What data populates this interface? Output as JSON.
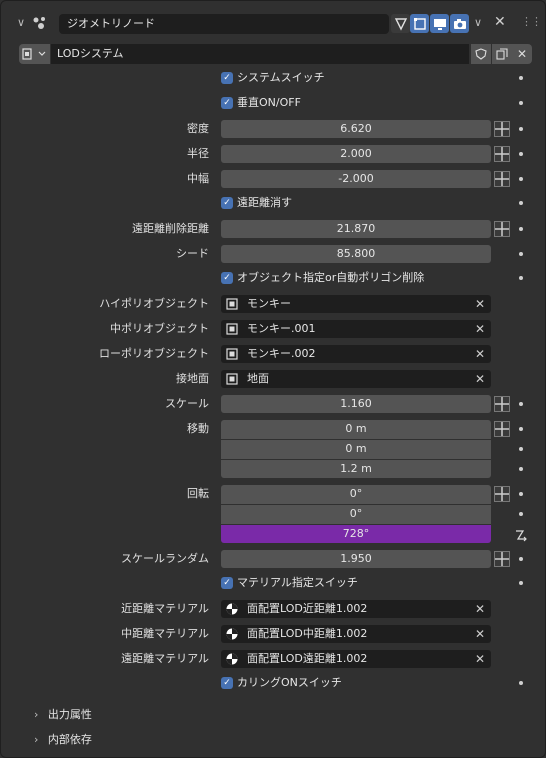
{
  "header": {
    "modifier_name": "ジオメトリノード",
    "nodegroup_name": "LODシステム"
  },
  "rows": {
    "system_switch": "システムスイッチ",
    "vertical_onoff": "垂直ON/OFF",
    "density_label": "密度",
    "density_value": "6.620",
    "radius_label": "半径",
    "radius_value": "2.000",
    "mid_width_label": "中幅",
    "mid_width_value": "-2.000",
    "far_delete": "遠距離消す",
    "far_delete_dist_label": "遠距離削除距離",
    "far_delete_dist_value": "21.870",
    "seed_label": "シード",
    "seed_value": "85.800",
    "object_or_auto": "オブジェクト指定or自動ポリゴン削除",
    "high_poly_label": "ハイポリオブジェクト",
    "high_poly_value": "モンキー",
    "mid_poly_label": "中ポリオブジェクト",
    "mid_poly_value": "モンキー.001",
    "low_poly_label": "ローポリオブジェクト",
    "low_poly_value": "モンキー.002",
    "ground_label": "接地面",
    "ground_value": "地面",
    "scale_label": "スケール",
    "scale_value": "1.160",
    "move_label": "移動",
    "move_x": "0 m",
    "move_y": "0 m",
    "move_z": "1.2 m",
    "rotation_label": "回転",
    "rot_x": "0°",
    "rot_y": "0°",
    "rot_z": "728°",
    "scale_random_label": "スケールランダム",
    "scale_random_value": "1.950",
    "material_switch": "マテリアル指定スイッチ",
    "near_mat_label": "近距離マテリアル",
    "near_mat_value": "面配置LOD近距離1.002",
    "mid_mat_label": "中距離マテリアル",
    "mid_mat_value": "面配置LOD中距離1.002",
    "far_mat_label": "遠距離マテリアル",
    "far_mat_value": "面配置LOD遠距離1.002",
    "culling_switch": "カリングONスイッチ"
  },
  "panels": {
    "output_attrs": "出力属性",
    "internal_deps": "内部依存"
  },
  "colors": {
    "accent": "#4772b3",
    "animated": "#7a2aa8",
    "field": "#545454",
    "dark_field": "#1e1e1e",
    "background": "#303030"
  }
}
